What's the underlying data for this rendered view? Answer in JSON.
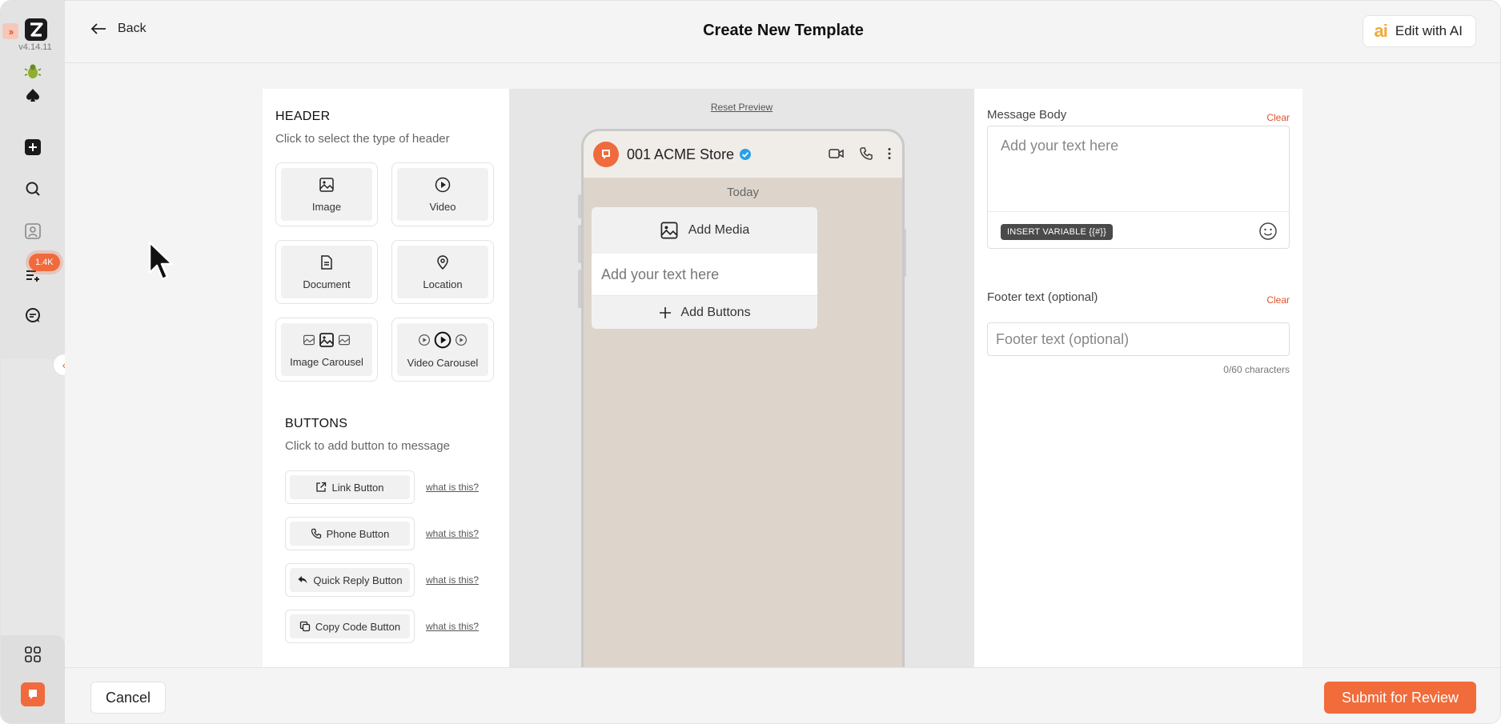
{
  "app": {
    "version": "v4.14.11",
    "notification_count": "1.4K"
  },
  "header": {
    "back_label": "Back",
    "title": "Create New Template",
    "ai_mark": "ai",
    "ai_button_label": "Edit with AI"
  },
  "header_section": {
    "title": "HEADER",
    "subtitle": "Click to select the type of header",
    "options": [
      "Image",
      "Video",
      "Document",
      "Location",
      "Image Carousel",
      "Video Carousel"
    ]
  },
  "buttons_section": {
    "title": "BUTTONS",
    "subtitle": "Click to add button to message",
    "items": [
      {
        "label": "Link Button",
        "help": "what is this?"
      },
      {
        "label": "Phone Button",
        "help": "what is this?"
      },
      {
        "label": "Quick Reply Button",
        "help": "what is this?"
      },
      {
        "label": "Copy Code Button",
        "help": "what is this?"
      }
    ]
  },
  "preview": {
    "reset_label": "Reset Preview",
    "contact_name": "001 ACME Store",
    "date_divider": "Today",
    "add_media_label": "Add Media",
    "text_placeholder": "Add your text here",
    "add_buttons_label": "Add Buttons",
    "bg_color": "#ddd5cb"
  },
  "message_body": {
    "label": "Message Body",
    "clear_label": "Clear",
    "placeholder": "Add your text here",
    "insert_variable_label": "INSERT VARIABLE {{#}}"
  },
  "footer_field": {
    "label": "Footer text (optional)",
    "clear_label": "Clear",
    "placeholder": "Footer text (optional)",
    "char_count": "0/60 characters"
  },
  "actions": {
    "cancel_label": "Cancel",
    "submit_label": "Submit for Review"
  },
  "colors": {
    "accent": "#f26b3a",
    "verified": "#2aa0e8"
  }
}
